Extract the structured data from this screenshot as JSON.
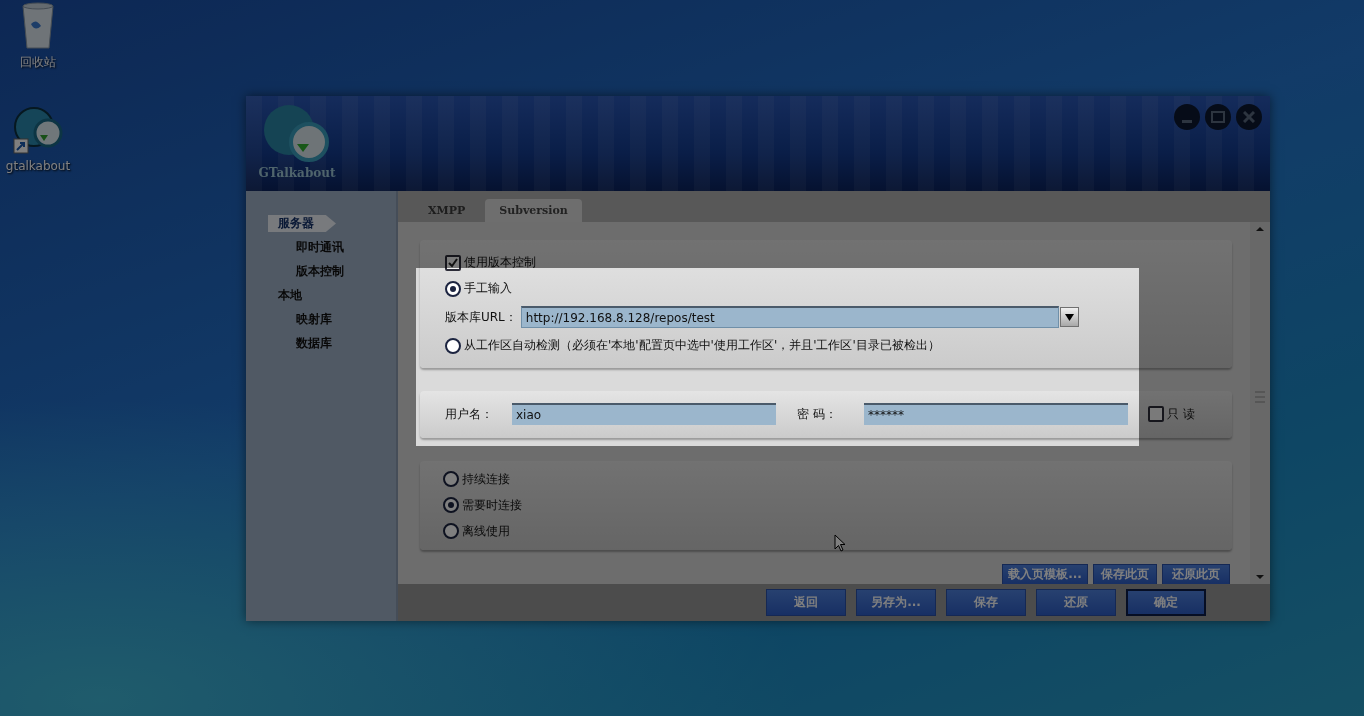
{
  "desktop_icons": [
    {
      "label": "回收站",
      "kind": "recycle-bin"
    },
    {
      "label": "gtalkabout",
      "kind": "shortcut"
    }
  ],
  "window": {
    "logo_text": "GTalkabout"
  },
  "sidebar": {
    "items": [
      {
        "label": "服务器",
        "selected": true,
        "children": [
          {
            "label": "即时通讯",
            "selected": false
          },
          {
            "label": "版本控制",
            "selected": false
          }
        ]
      },
      {
        "label": "本地",
        "selected": false,
        "children": [
          {
            "label": "映射库",
            "selected": false
          },
          {
            "label": "数据库",
            "selected": false
          }
        ]
      }
    ]
  },
  "tabs": [
    {
      "label": "XMPP",
      "selected": false
    },
    {
      "label": "Subversion",
      "selected": true
    }
  ],
  "repository": {
    "use_version_control": {
      "label": "使用版本控制",
      "checked": true
    },
    "source_options": [
      {
        "label": "手工输入",
        "selected": true
      },
      {
        "label": "从工作区自动检测（必须在'本地'配置页中选中'使用工作区'，并且'工作区'目录已被检出）",
        "selected": false
      }
    ],
    "url_label": "版本库URL：",
    "url_value": "http://192.168.8.128/repos/test"
  },
  "credentials": {
    "username_label": "用户名：",
    "username": "xiao",
    "password_label": "密 码：",
    "password": "******",
    "read_only": {
      "label": "只 读",
      "checked": false
    }
  },
  "connection": {
    "options": [
      {
        "label": "持续连接",
        "selected": false
      },
      {
        "label": "需要时连接",
        "selected": true
      },
      {
        "label": "离线使用",
        "selected": false
      }
    ]
  },
  "page_buttons": [
    "载入页模板...",
    "保存此页",
    "还原此页"
  ],
  "dialog_buttons": [
    {
      "label": "返回",
      "default": false
    },
    {
      "label": "另存为...",
      "default": false
    },
    {
      "label": "保存",
      "default": false
    },
    {
      "label": "还原",
      "default": false
    },
    {
      "label": "确定",
      "default": true
    }
  ]
}
